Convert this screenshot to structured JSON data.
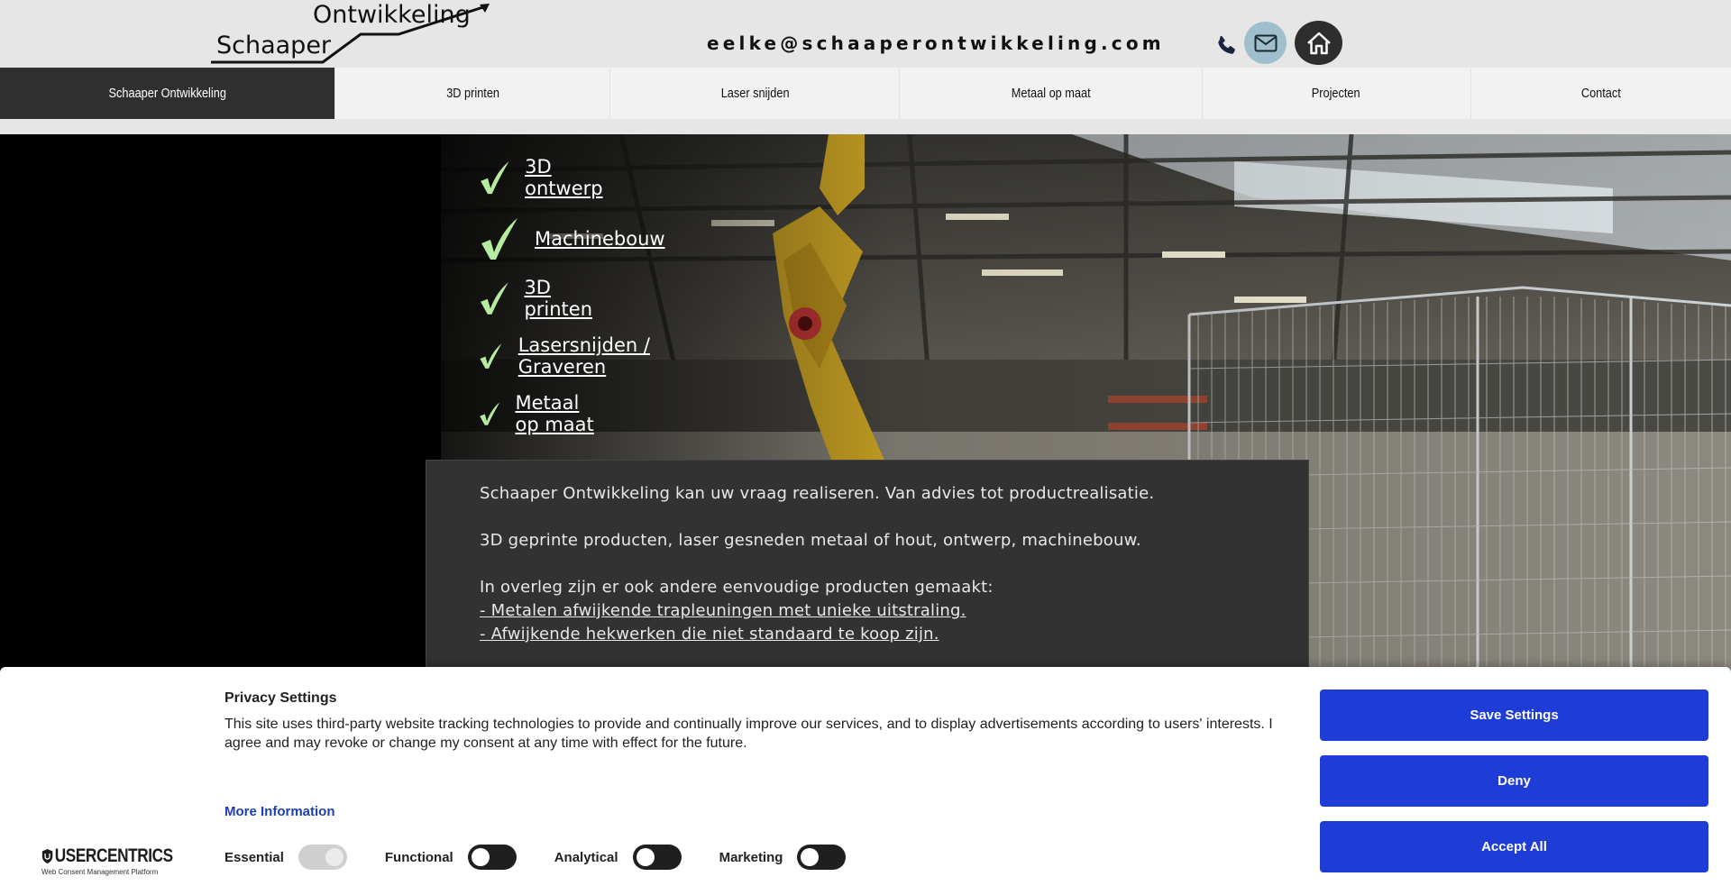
{
  "header": {
    "logo": {
      "line1": "Ontwikkeling",
      "line2": "Schaaper"
    },
    "email": "eelke@schaaperontwikkeling.com",
    "icons": {
      "phone": "phone-icon",
      "mail": "mail-icon",
      "home": "home-icon"
    }
  },
  "nav": {
    "items": [
      {
        "label": "Schaaper Ontwikkeling",
        "active": true
      },
      {
        "label": "3D printen"
      },
      {
        "label": "Laser snijden"
      },
      {
        "label": "Metaal op maat"
      },
      {
        "label": "Projecten"
      },
      {
        "label": "Contact"
      }
    ]
  },
  "hero": {
    "services": [
      {
        "label": "3D ontwerp"
      },
      {
        "label": "Machinebouw"
      },
      {
        "label": "3D printen"
      },
      {
        "label": "Lasersnijden / Graveren"
      },
      {
        "label": "Metaal op maat"
      }
    ],
    "text": {
      "line1": "Schaaper Ontwikkeling kan uw vraag realiseren.  Van advies tot productrealisatie.",
      "line2": "3D geprinte producten, laser gesneden metaal of hout, ontwerp, machinebouw.",
      "line3": "In overleg zijn er ook andere eenvoudige producten gemaakt:",
      "link1": "- Metalen afwijkende trapleuningen met unieke uitstraling.",
      "link2": "- Afwijkende hekwerken die niet standaard te koop zijn."
    }
  },
  "consent": {
    "brand": "USERCENTRICS",
    "brand_sub": "Web Consent Management Platform",
    "title": "Privacy Settings",
    "body": "This site uses third-party website tracking technologies to provide and continually improve our services, and to display advertisements according to users' interests. I agree and may revoke or change my consent at any time with effect for the future.",
    "more_info": "More Information",
    "toggles": {
      "essential": "Essential",
      "functional": "Functional",
      "analytical": "Analytical",
      "marketing": "Marketing"
    },
    "buttons": {
      "save": "Save Settings",
      "deny": "Deny",
      "accept": "Accept All"
    },
    "accent_color": "#1e3dd6"
  }
}
